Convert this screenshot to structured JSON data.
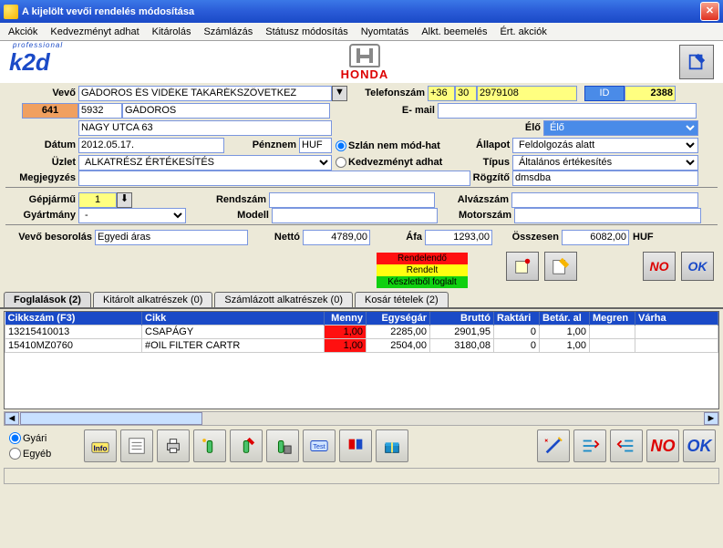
{
  "window": {
    "title": "A kijelölt vevői rendelés módosítása"
  },
  "menu": [
    "Akciók",
    "Kedvezményt adhat",
    "Kitárolás",
    "Számlázás",
    "Státusz módosítás",
    "Nyomtatás",
    "Alkt. beemelés",
    "Ért. akciók"
  ],
  "brand": {
    "name": "HONDA"
  },
  "fields": {
    "vevo_label": "Vevő",
    "vevo_name": "GÁDOROS ÉS VIDÉKE TAKARÉKSZÖVETKEZ",
    "telefon_label": "Telefonszám",
    "phone_cc": "+36",
    "phone_area": "30",
    "phone_num": "2979108",
    "id_label": "ID",
    "id_val": "2388",
    "code1": "641",
    "code2": "5932",
    "city": "GÁDOROS",
    "email_label": "E- mail",
    "email_val": "",
    "addr": "NAGY UTCA 63",
    "elo_label": "Élő",
    "elo_val": "Élő",
    "datum_label": "Dátum",
    "datum_val": "2012.05.17.",
    "penznem_label": "Pénznem",
    "penznem_val": "HUF",
    "radio1": "Szlán nem mód-hat",
    "radio2": "Kedvezményt adhat",
    "allapot_label": "Állapot",
    "allapot_val": "Feldolgozás alatt",
    "uzlet_label": "Üzlet",
    "uzlet_val": "ALKATRÉSZ ÉRTÉKESÍTÉS",
    "tipus_label": "Típus",
    "tipus_val": "Általános értékesítés",
    "megjegyzes_label": "Megjegyzés",
    "rogzito_label": "Rögzítő",
    "rogzito_val": "dmsdba",
    "gepjarmu_label": "Gépjármű",
    "gepjarmu_val": "1",
    "rendszam_label": "Rendszám",
    "alvazszam_label": "Alvázszám",
    "gyartmany_label": "Gyártmány",
    "gyartmany_val": "-",
    "modell_label": "Modell",
    "motorszam_label": "Motorszám",
    "besorolas_label": "Vevő besorolás",
    "besorolas_val": "Egyedi áras",
    "netto_label": "Nettó",
    "netto_val": "4789,00",
    "afa_label": "Áfa",
    "afa_val": "1293,00",
    "osszesen_label": "Összesen",
    "osszesen_val": "6082,00",
    "huf": "HUF"
  },
  "legend": {
    "red": "Rendelendő",
    "yellow": "Rendelt",
    "green": "Készletből foglalt"
  },
  "tabs": [
    "Foglalások (2)",
    "Kitárolt alkatrészek (0)",
    "Számlázott alkatrészek (0)",
    "Kosár tételek (2)"
  ],
  "table": {
    "cols": [
      "Cikkszám (F3)",
      "Cikk",
      "Menny",
      "Egységár",
      "Bruttó",
      "Raktári",
      "Betár. al",
      "Megren",
      "Várha"
    ],
    "rows": [
      {
        "szam": "13215410013",
        "cikk": "CSAPÁGY",
        "menny": "1,00",
        "egysegar": "2285,00",
        "brutto": "2901,95",
        "raktari": "0",
        "betar": "1,00"
      },
      {
        "szam": "15410MZ0760",
        "cikk": "#OIL FILTER CARTR",
        "menny": "1,00",
        "egysegar": "2504,00",
        "brutto": "3180,08",
        "raktari": "0",
        "betar": "1,00"
      }
    ]
  },
  "radios_bottom": {
    "gyari": "Gyári",
    "egyeb": "Egyéb"
  },
  "buttons": {
    "no": "NO",
    "ok": "OK"
  }
}
